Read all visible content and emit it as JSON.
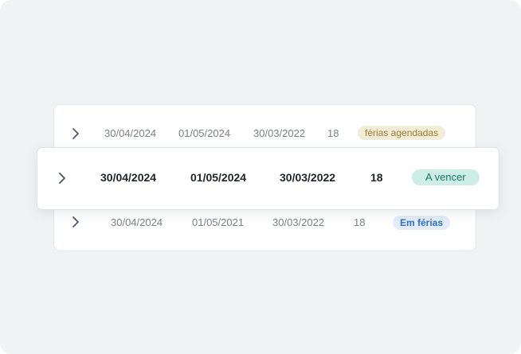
{
  "colors": {
    "background": "#f0f3f4",
    "card": "#ffffff",
    "muted_text": "#7b8187",
    "strong_text": "#1f2328",
    "chevron": "#4a5a6a"
  },
  "rows": [
    {
      "start": "30/04/2024",
      "end": "01/05/2024",
      "acquisition": "30/03/2022",
      "days": "18",
      "status": "férias agendadas",
      "status_color": "#9a7a2c"
    },
    {
      "start": "30/04/2024",
      "end": "01/05/2024",
      "acquisition": "30/03/2022",
      "days": "18",
      "status": "A vencer",
      "status_color": "#1b7a64"
    },
    {
      "start": "30/04/2024",
      "end": "01/05/2021",
      "acquisition": "30/03/2022",
      "days": "18",
      "status": "Em férias",
      "status_color": "#2f6fd0"
    }
  ]
}
